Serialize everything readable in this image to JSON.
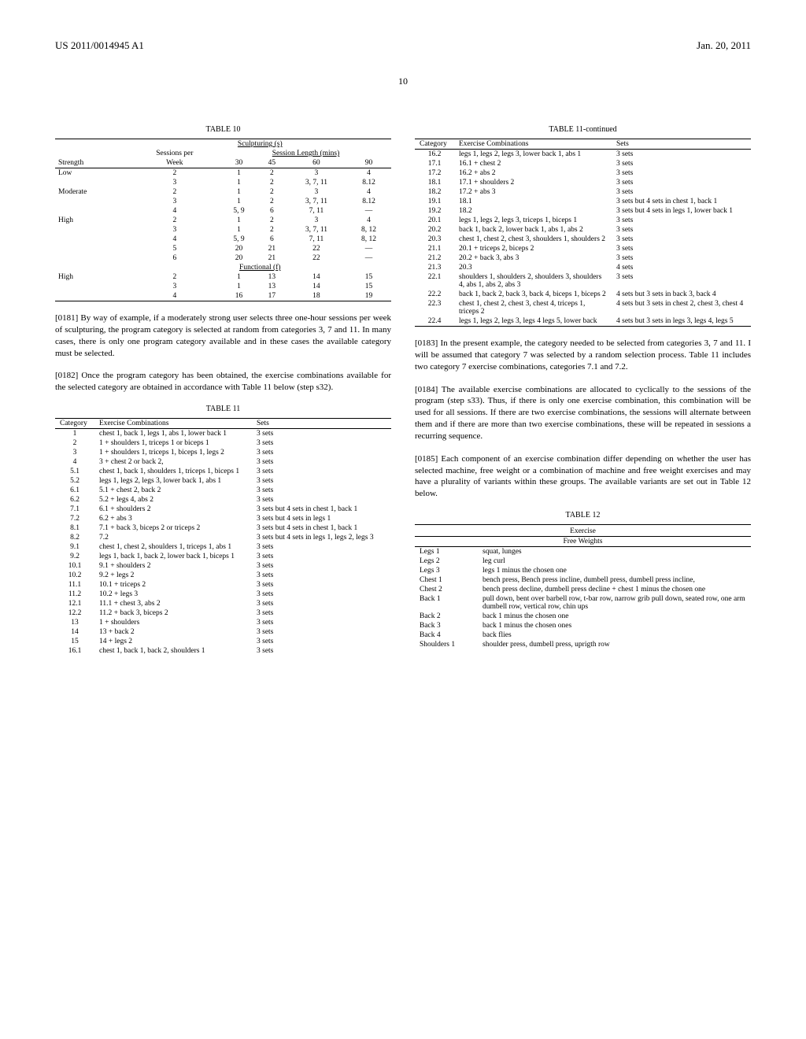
{
  "header": {
    "docnum": "US 2011/0014945 A1",
    "date": "Jan. 20, 2011",
    "page": "10"
  },
  "table10": {
    "caption": "TABLE 10",
    "subhead_sculpt": "Sculpturing (s)",
    "col_sessions": "Sessions per",
    "col_sessionlen": "Session Length (mins)",
    "col_strength": "Strength",
    "col_week": "Week",
    "lens": [
      "30",
      "45",
      "60",
      "90"
    ],
    "func_label": "Functional (f)",
    "rows_s": [
      {
        "strength": "Low",
        "sessions": "2",
        "v": [
          "1",
          "2",
          "3",
          "4"
        ]
      },
      {
        "strength": "",
        "sessions": "3",
        "v": [
          "1",
          "2",
          "3, 7, 11",
          "8.12"
        ]
      },
      {
        "strength": "Moderate",
        "sessions": "2",
        "v": [
          "1",
          "2",
          "3",
          "4"
        ]
      },
      {
        "strength": "",
        "sessions": "3",
        "v": [
          "1",
          "2",
          "3, 7, 11",
          "8.12"
        ]
      },
      {
        "strength": "",
        "sessions": "4",
        "v": [
          "5, 9",
          "6",
          "7, 11",
          "—"
        ]
      },
      {
        "strength": "High",
        "sessions": "2",
        "v": [
          "1",
          "2",
          "3",
          "4"
        ]
      },
      {
        "strength": "",
        "sessions": "3",
        "v": [
          "1",
          "2",
          "3, 7, 11",
          "8, 12"
        ]
      },
      {
        "strength": "",
        "sessions": "4",
        "v": [
          "5, 9",
          "6",
          "7, 11",
          "8, 12"
        ]
      },
      {
        "strength": "",
        "sessions": "5",
        "v": [
          "20",
          "21",
          "22",
          "—"
        ]
      },
      {
        "strength": "",
        "sessions": "6",
        "v": [
          "20",
          "21",
          "22",
          "—"
        ]
      }
    ],
    "rows_f": [
      {
        "strength": "High",
        "sessions": "2",
        "v": [
          "1",
          "13",
          "14",
          "15"
        ]
      },
      {
        "strength": "",
        "sessions": "3",
        "v": [
          "1",
          "13",
          "14",
          "15"
        ]
      },
      {
        "strength": "",
        "sessions": "4",
        "v": [
          "16",
          "17",
          "18",
          "19"
        ]
      }
    ]
  },
  "para0181": "[0181]   By way of example, if a moderately strong user selects three one-hour sessions per week of sculpturing, the program category is selected at random from categories 3, 7 and 11. In many cases, there is only one program category available and in these cases the available category must be selected.",
  "para0182": "[0182]   Once the program category has been obtained, the exercise combinations available for the selected category are obtained in accordance with Table 11 below (step s32).",
  "table11": {
    "caption": "TABLE 11",
    "cols": [
      "Category",
      "Exercise Combinations",
      "Sets"
    ],
    "rows_left": [
      {
        "c": "1",
        "e": "chest 1, back 1, legs 1, abs 1, lower back 1",
        "s": "3 sets"
      },
      {
        "c": "2",
        "e": "1 + shoulders 1, triceps 1 or biceps 1",
        "s": "3 sets"
      },
      {
        "c": "3",
        "e": "1 + shoulders 1, triceps 1, biceps 1, legs 2",
        "s": "3 sets"
      },
      {
        "c": "4",
        "e": "3 + chest 2 or back 2,",
        "s": "3 sets"
      },
      {
        "c": "5.1",
        "e": "chest 1, back 1, shoulders 1, triceps 1, biceps 1",
        "s": "3 sets"
      },
      {
        "c": "5.2",
        "e": "legs 1, legs 2, legs 3, lower back 1, abs 1",
        "s": "3 sets"
      },
      {
        "c": "6.1",
        "e": "5.1 + chest 2, back 2",
        "s": "3 sets"
      },
      {
        "c": "6.2",
        "e": "5.2 + legs 4, abs 2",
        "s": "3 sets"
      },
      {
        "c": "7.1",
        "e": "6.1 + shoulders 2",
        "s": "3 sets but 4 sets in chest 1, back 1"
      },
      {
        "c": "7.2",
        "e": "6.2 + abs 3",
        "s": "3 sets but 4 sets in legs 1"
      },
      {
        "c": "8.1",
        "e": "7.1 + back 3, biceps 2 or triceps 2",
        "s": "3 sets but 4 sets in chest 1, back 1"
      },
      {
        "c": "8.2",
        "e": "7.2",
        "s": "3 sets but 4 sets in legs 1, legs 2, legs 3"
      },
      {
        "c": "9.1",
        "e": "chest 1, chest 2, shoulders 1, triceps 1, abs 1",
        "s": "3 sets"
      },
      {
        "c": "9.2",
        "e": "legs 1, back 1, back 2, lower back 1, biceps 1",
        "s": "3 sets"
      },
      {
        "c": "10.1",
        "e": "9.1 + shoulders 2",
        "s": "3 sets"
      },
      {
        "c": "10.2",
        "e": "9.2 + legs 2",
        "s": "3 sets"
      },
      {
        "c": "11.1",
        "e": "10.1 + triceps 2",
        "s": "3 sets"
      },
      {
        "c": "11.2",
        "e": "10.2 + legs 3",
        "s": "3 sets"
      },
      {
        "c": "12.1",
        "e": "11.1 + chest 3, abs 2",
        "s": "3 sets"
      },
      {
        "c": "12.2",
        "e": "11.2 + back 3, biceps 2",
        "s": "3 sets"
      },
      {
        "c": "13",
        "e": "1 + shoulders",
        "s": "3 sets"
      },
      {
        "c": "14",
        "e": "13 + back 2",
        "s": "3 sets"
      },
      {
        "c": "15",
        "e": "14 + legs 2",
        "s": "3 sets"
      },
      {
        "c": "16.1",
        "e": "chest 1, back 1, back 2, shoulders 1",
        "s": "3 sets"
      }
    ],
    "caption_cont": "TABLE 11-continued",
    "rows_right": [
      {
        "c": "16.2",
        "e": "legs 1, legs 2, legs 3, lower back 1, abs 1",
        "s": "3 sets"
      },
      {
        "c": "17.1",
        "e": "16.1 + chest 2",
        "s": "3 sets"
      },
      {
        "c": "17.2",
        "e": "16.2 + abs 2",
        "s": "3 sets"
      },
      {
        "c": "18.1",
        "e": "17.1 + shoulders 2",
        "s": "3 sets"
      },
      {
        "c": "18.2",
        "e": "17.2 + abs 3",
        "s": "3 sets"
      },
      {
        "c": "19.1",
        "e": "18.1",
        "s": "3 sets but 4 sets in chest 1, back 1"
      },
      {
        "c": "19.2",
        "e": "18.2",
        "s": "3 sets but 4 sets in legs 1, lower back 1"
      },
      {
        "c": "20.1",
        "e": "legs 1, legs 2, legs 3, triceps 1, biceps 1",
        "s": "3 sets"
      },
      {
        "c": "20.2",
        "e": "back 1, back 2, lower back 1, abs 1, abs 2",
        "s": "3 sets"
      },
      {
        "c": "20.3",
        "e": "chest 1, chest 2, chest 3, shoulders 1, shoulders 2",
        "s": "3 sets"
      },
      {
        "c": "21.1",
        "e": "20.1 + triceps 2, biceps 2",
        "s": "3 sets"
      },
      {
        "c": "21.2",
        "e": "20.2 + back 3, abs 3",
        "s": "3 sets"
      },
      {
        "c": "21.3",
        "e": "20.3",
        "s": "4 sets"
      },
      {
        "c": "22.1",
        "e": "shoulders 1, shoulders 2, shoulders 3, shoulders 4, abs 1, abs 2, abs 3",
        "s": "3 sets"
      },
      {
        "c": "22.2",
        "e": "back 1, back 2, back 3, back 4, biceps 1, biceps 2",
        "s": "4 sets but 3 sets in back 3, back 4"
      },
      {
        "c": "22.3",
        "e": "chest 1, chest 2, chest 3, chest 4, triceps 1, triceps 2",
        "s": "4 sets but 3 sets in chest 2, chest 3, chest 4"
      },
      {
        "c": "22.4",
        "e": "legs 1, legs 2, legs 3, legs 4 legs 5, lower back",
        "s": "4 sets but 3 sets in legs 3, legs 4, legs 5"
      }
    ]
  },
  "para0183": "[0183]   In the present example, the category needed to be selected from categories 3, 7 and 11. I will be assumed that category 7 was selected by a random selection process. Table 11 includes two category 7 exercise combinations, categories 7.1 and 7.2.",
  "para0184": "[0184]   The available exercise combinations are allocated to cyclically to the sessions of the program (step s33). Thus, if there is only one exercise combination, this combination will be used for all sessions. If there are two exercise combinations, the sessions will alternate between them and if there are more than two exercise combinations, these will be repeated in sessions a recurring sequence.",
  "para0185": "[0185]   Each component of an exercise combination differ depending on whether the user has selected machine, free weight or a combination of machine and free weight exercises and may have a plurality of variants within these groups. The available variants are set out in Table 12 below.",
  "table12": {
    "caption": "TABLE 12",
    "head1": "Exercise",
    "head2": "Free Weights",
    "rows": [
      {
        "p": "Legs 1",
        "e": "squat, lunges"
      },
      {
        "p": "Legs 2",
        "e": "leg curl"
      },
      {
        "p": "Legs 3",
        "e": "legs 1 minus the chosen one"
      },
      {
        "p": "Chest 1",
        "e": "bench press, Bench press incline, dumbell press, dumbell press incline,"
      },
      {
        "p": "Chest 2",
        "e": "bench press decline, dumbell press decline + chest 1 minus the chosen one"
      },
      {
        "p": "Back 1",
        "e": "pull down, bent over barbell row, t-bar row, narrow grib pull down, seated row, one arm dumbell row, vertical row, chin ups"
      },
      {
        "p": "Back 2",
        "e": "back 1 minus the chosen one"
      },
      {
        "p": "Back 3",
        "e": "back 1 minus the chosen ones"
      },
      {
        "p": "Back 4",
        "e": "back flies"
      },
      {
        "p": "Shoulders 1",
        "e": "shoulder press, dumbell press, uprigth row"
      }
    ]
  }
}
